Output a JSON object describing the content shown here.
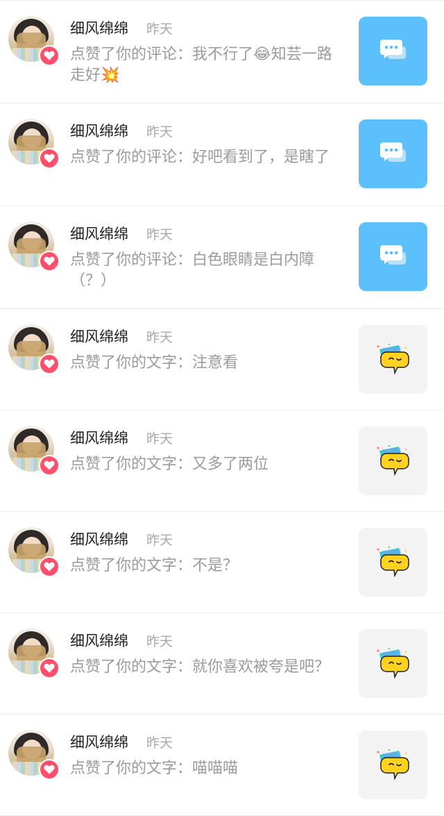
{
  "notifications": [
    {
      "username": "细风绵绵",
      "time": "昨天",
      "content": "点赞了你的评论：我不行了😂知芸一路走好💥",
      "thumb_type": "comment"
    },
    {
      "username": "细风绵绵",
      "time": "昨天",
      "content": "点赞了你的评论：好吧看到了，是瞎了",
      "thumb_type": "comment"
    },
    {
      "username": "细风绵绵",
      "time": "昨天",
      "content": "点赞了你的评论：白色眼睛是白内障（？）",
      "thumb_type": "comment"
    },
    {
      "username": "细风绵绵",
      "time": "昨天",
      "content": "点赞了你的文字：注意看",
      "thumb_type": "text"
    },
    {
      "username": "细风绵绵",
      "time": "昨天",
      "content": "点赞了你的文字：又多了两位",
      "thumb_type": "text"
    },
    {
      "username": "细风绵绵",
      "time": "昨天",
      "content": "点赞了你的文字：不是？",
      "thumb_type": "text"
    },
    {
      "username": "细风绵绵",
      "time": "昨天",
      "content": "点赞了你的文字：就你喜欢被夸是吧？",
      "thumb_type": "text"
    },
    {
      "username": "细风绵绵",
      "time": "昨天",
      "content": "点赞了你的文字：喵喵喵",
      "thumb_type": "text"
    }
  ],
  "colors": {
    "comment_thumb_bg": "#5cc0fd",
    "text_thumb_bg": "#f3f3f3",
    "heart_badge": "#ff4f6d",
    "username": "#222222",
    "secondary": "#9b9b9b"
  },
  "icons": {
    "avatar_badge": "heart-icon",
    "comment_thumb": "chat-bubbles-icon",
    "text_thumb": "emoji-chat-bubble-icon"
  }
}
